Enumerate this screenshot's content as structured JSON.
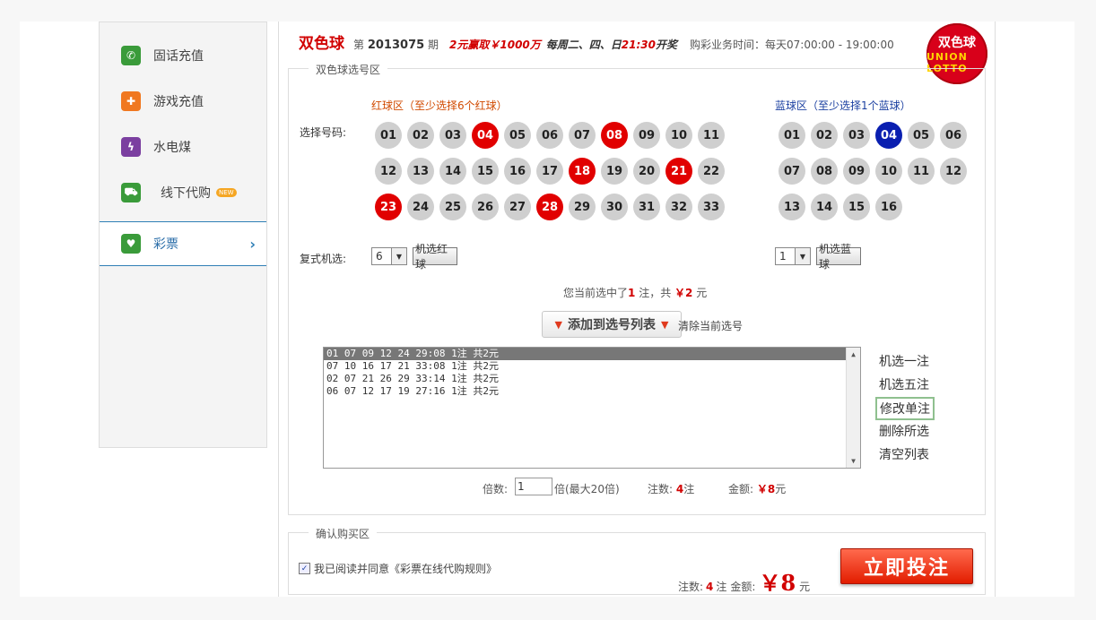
{
  "sidebar": {
    "items": [
      {
        "label": "固话充值",
        "icon": "phone-icon",
        "color": "#3a9b3a"
      },
      {
        "label": "游戏充值",
        "icon": "gamepad-icon",
        "color": "#f07820"
      },
      {
        "label": "水电煤",
        "icon": "utility-icon",
        "color": "#7b3fa0"
      },
      {
        "label": "线下代购",
        "icon": "cart-icon",
        "color": "#3a9b3a",
        "badge": "NEW"
      },
      {
        "label": "彩票",
        "icon": "lottery-icon",
        "color": "#3a9b3a",
        "active": true
      }
    ]
  },
  "header": {
    "title": "双色球",
    "issue_prefix": "第",
    "issue_number": "2013075",
    "issue_suffix": "期",
    "promo": "2元赢取￥1000万",
    "schedule_prefix": "每周二、四、日",
    "schedule_time": "21:30",
    "schedule_suffix": "开奖",
    "business_hours": "购彩业务时间：每天07:00:00 - 19:00:00",
    "logo_top": "双色球",
    "logo_bottom": "UNION LOTTO"
  },
  "selection": {
    "legend": "双色球选号区",
    "red_zone_label": "红球区（至少选择6个红球）",
    "blue_zone_label": "蓝球区（至少选择1个蓝球）",
    "choose_label": "选择号码:",
    "red_balls": [
      "01",
      "02",
      "03",
      "04",
      "05",
      "06",
      "07",
      "08",
      "09",
      "10",
      "11",
      "12",
      "13",
      "14",
      "15",
      "16",
      "17",
      "18",
      "19",
      "20",
      "21",
      "22",
      "23",
      "24",
      "25",
      "26",
      "27",
      "28",
      "29",
      "30",
      "31",
      "32",
      "33"
    ],
    "red_selected": [
      "04",
      "08",
      "18",
      "21",
      "23",
      "28"
    ],
    "blue_balls": [
      "01",
      "02",
      "03",
      "04",
      "05",
      "06",
      "07",
      "08",
      "09",
      "10",
      "11",
      "12",
      "13",
      "14",
      "15",
      "16"
    ],
    "blue_selected": [
      "04"
    ],
    "multi_label": "复式机选:",
    "red_count": "6",
    "red_random_button": "机选红球",
    "blue_count": "1",
    "blue_random_button": "机选蓝球",
    "current_prefix": "您当前选中了",
    "current_bets": "1",
    "current_mid": "注，共",
    "current_amount": "￥2",
    "current_suffix": "元",
    "add_button": "添加到选号列表",
    "clear_current": "清除当前选号",
    "list": [
      "01 07 09 12 24 29:08 1注 共2元",
      "07 10 16 17 21 33:08 1注 共2元",
      "02 07 21 26 29 33:14 1注 共2元",
      "06 07 12 17 19 27:16 1注 共2元"
    ],
    "actions": [
      "机选一注",
      "机选五注",
      "修改单注",
      "删除所选",
      "清空列表"
    ],
    "multiplier_label": "倍数:",
    "multiplier_value": "1",
    "multiplier_hint": "倍(最大20倍)",
    "bets_label": "注数:",
    "bets_value": "4",
    "bets_unit": "注",
    "amount_label": "金额:",
    "amount_value": "￥8",
    "amount_unit": "元"
  },
  "confirm": {
    "legend": "确认购买区",
    "agree_text": "我已阅读并同意《彩票在线代购规则》",
    "bets_label": "注数:",
    "bets_value": "4",
    "bets_unit": "注",
    "amount_label": "金额:",
    "amount_value": "￥8",
    "amount_unit": "元",
    "submit_button": "立即投注"
  }
}
